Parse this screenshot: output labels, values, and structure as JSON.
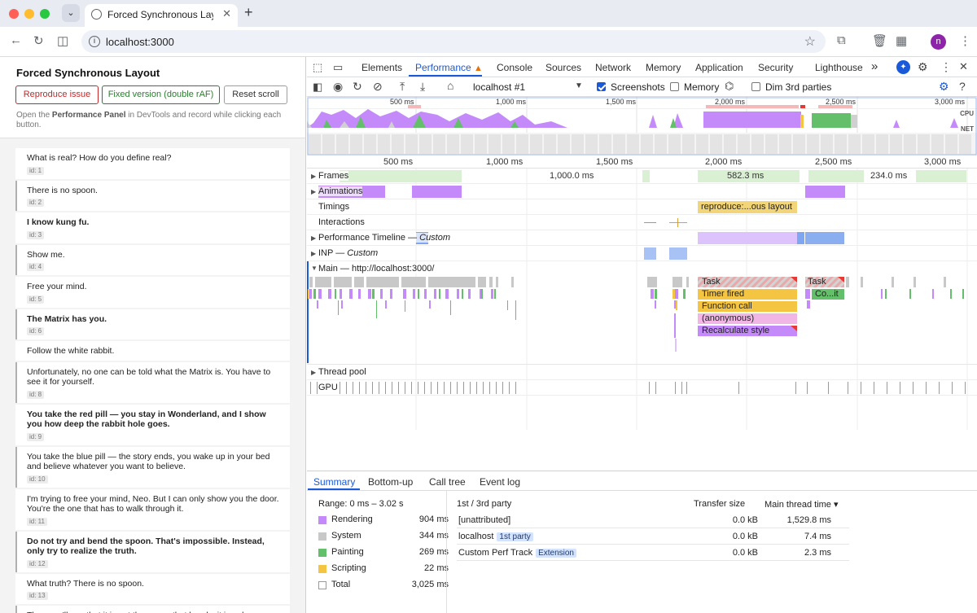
{
  "browser": {
    "tab_title": "Forced Synchronous Layout D",
    "url": "localhost:3000",
    "avatar_letter": "n"
  },
  "page": {
    "title": "Forced Synchronous Layout",
    "buttons": {
      "reproduce": "Reproduce issue",
      "fixed": "Fixed version (double rAF)",
      "reset": "Reset scroll"
    },
    "desc_pre": "Open the ",
    "desc_bold": "Performance Panel",
    "desc_post": " in DevTools and record while clicking each button.",
    "items": [
      {
        "text": "What is real? How do you define real?",
        "id": "id: 1",
        "bold": false,
        "marked": false
      },
      {
        "text": "There is no spoon.",
        "id": "id: 2",
        "bold": false,
        "marked": true
      },
      {
        "text": "I know kung fu.",
        "id": "id: 3",
        "bold": true,
        "marked": false
      },
      {
        "text": "Show me.",
        "id": "id: 4",
        "bold": false,
        "marked": true
      },
      {
        "text": "Free your mind.",
        "id": "id: 5",
        "bold": false,
        "marked": false
      },
      {
        "text": "The Matrix has you.",
        "id": "id: 6",
        "bold": true,
        "marked": true
      },
      {
        "text": "Follow the white rabbit.",
        "id": "",
        "bold": false,
        "marked": false
      },
      {
        "text": "Unfortunately, no one can be told what the Matrix is. You have to see it for yourself.",
        "id": "id: 8",
        "bold": false,
        "marked": true
      },
      {
        "text": "You take the red pill — you stay in Wonderland, and I show you how deep the rabbit hole goes.",
        "id": "id: 9",
        "bold": true,
        "marked": false
      },
      {
        "text": "You take the blue pill — the story ends, you wake up in your bed and believe whatever you want to believe.",
        "id": "id: 10",
        "bold": false,
        "marked": true
      },
      {
        "text": "I'm trying to free your mind, Neo. But I can only show you the door. You're the one that has to walk through it.",
        "id": "id: 11",
        "bold": false,
        "marked": false
      },
      {
        "text": "Do not try and bend the spoon. That's impossible. Instead, only try to realize the truth.",
        "id": "id: 12",
        "bold": true,
        "marked": true
      },
      {
        "text": "What truth? There is no spoon.",
        "id": "id: 13",
        "bold": false,
        "marked": false
      },
      {
        "text": "Then you'll see that it is not the spoon that bends, it is only yourself.",
        "id": "",
        "bold": false,
        "marked": true
      }
    ]
  },
  "devtools": {
    "tabs": [
      "Elements",
      "Performance",
      "Console",
      "Sources",
      "Network",
      "Memory",
      "Application",
      "Security",
      "Lighthouse"
    ],
    "active_tab": "Performance",
    "more": "»",
    "toolbar": {
      "target": "localhost #1",
      "screenshots_label": "Screenshots",
      "screenshots_checked": true,
      "memory_label": "Memory",
      "memory_checked": false,
      "dim_label": "Dim 3rd parties",
      "dim_checked": false
    },
    "overview_labels": [
      "500 ms",
      "1,000 ms",
      "1,500 ms",
      "2,000 ms",
      "2,500 ms",
      "3,000 ms"
    ],
    "cpu_label": "CPU",
    "net_label": "NET",
    "ruler_labels": [
      "500 ms",
      "1,000 ms",
      "1,500 ms",
      "2,000 ms",
      "2,500 ms",
      "3,000 ms"
    ],
    "tracks": {
      "frames": "Frames",
      "animations": "Animations",
      "timings": "Timings",
      "interactions": "Interactions",
      "perf_timeline": "Performance Timeline",
      "perf_timeline_sub": "Custom",
      "inp": "INP",
      "inp_sub": "Custom",
      "main": "Main — http://localhost:3000/",
      "thread_pool": "Thread pool",
      "gpu": "GPU"
    },
    "frame_durations": [
      "1,000.0 ms",
      "582.3 ms",
      "234.0 ms"
    ],
    "timing_label": "reproduce:...ous layout",
    "perf_timeline_mark": "Custom",
    "flame": {
      "task1": "Task",
      "task2": "Task",
      "timer": "Timer fired",
      "func": "Function call",
      "anon": "(anonymous)",
      "recalc": "Recalculate style",
      "co_it": "Co...it"
    },
    "colors": {
      "rendering": "#c58af9",
      "system": "#c8c8c8",
      "painting": "#63bf69",
      "scripting": "#f4c542",
      "accent": "#1a5ad8"
    },
    "summary": {
      "tabs": [
        "Summary",
        "Bottom-up",
        "Call tree",
        "Event log"
      ],
      "range": "Range: 0 ms – 3.02 s",
      "categories": [
        {
          "name": "Rendering",
          "value": "904 ms",
          "color": "#c58af9"
        },
        {
          "name": "System",
          "value": "344 ms",
          "color": "#c8c8c8"
        },
        {
          "name": "Painting",
          "value": "269 ms",
          "color": "#63bf69"
        },
        {
          "name": "Scripting",
          "value": "22 ms",
          "color": "#f4c542"
        },
        {
          "name": "Total",
          "value": "3,025 ms",
          "color": "#ffffff"
        }
      ],
      "party_header": "1st / 3rd party",
      "size_header": "Transfer size",
      "time_header": "Main thread time ▾",
      "parties": [
        {
          "name": "[unattributed]",
          "badge": "",
          "size": "0.0 kB",
          "time": "1,529.8 ms"
        },
        {
          "name": "localhost",
          "badge": "1st party",
          "size": "0.0 kB",
          "time": "7.4 ms"
        },
        {
          "name": "Custom Perf Track",
          "badge": "Extension",
          "size": "0.0 kB",
          "time": "2.3 ms"
        }
      ]
    }
  }
}
